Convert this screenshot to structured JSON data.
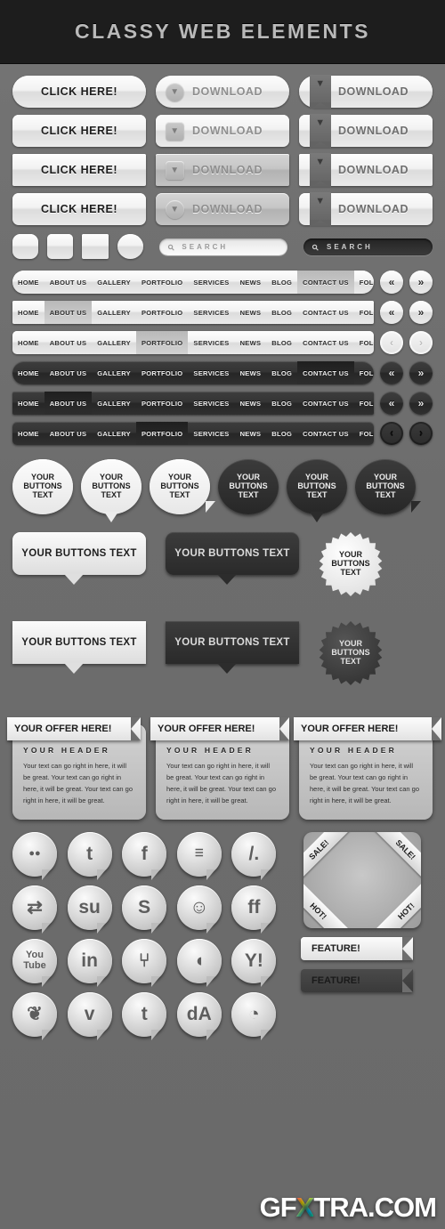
{
  "header": {
    "title": "CLASSY WEB ELEMENTS"
  },
  "buttons": {
    "click_label": "CLICK HERE!",
    "download_label": "DOWNLOAD",
    "rows": [
      {
        "shape": "pill"
      },
      {
        "shape": "soft"
      },
      {
        "shape": "square"
      },
      {
        "shape": "soft2"
      }
    ],
    "icons": {
      "chevron": "chevron-down-icon",
      "ribbon": "ribbon-bookmark-icon"
    }
  },
  "shapes": [
    {
      "name": "rounded-square-button"
    },
    {
      "name": "soft-square-button"
    },
    {
      "name": "square-button"
    },
    {
      "name": "circle-button"
    }
  ],
  "search": {
    "light_placeholder": "SEARCH",
    "dark_placeholder": "SEARCH",
    "icon": "magnifier-icon"
  },
  "nav": {
    "items": [
      "HOME",
      "ABOUT US",
      "GALLERY",
      "PORTFOLIO",
      "SERVICES",
      "NEWS",
      "BLOG",
      "CONTACT US",
      "FOLLOW US"
    ],
    "bars": [
      {
        "theme": "light",
        "shape": "pill",
        "active": "CONTACT US",
        "arrows": [
          "«",
          "»"
        ]
      },
      {
        "theme": "light",
        "shape": "square",
        "active": "ABOUT US",
        "arrows": [
          "«",
          "»"
        ]
      },
      {
        "theme": "light",
        "shape": "soft",
        "active": "PORTFOLIO",
        "arrows": [
          "‹",
          "›"
        ]
      },
      {
        "theme": "dark",
        "shape": "pill",
        "active": "CONTACT US",
        "arrows": [
          "«",
          "»"
        ]
      },
      {
        "theme": "dark",
        "shape": "square",
        "active": "ABOUT US",
        "arrows": [
          "«",
          "»"
        ]
      },
      {
        "theme": "dark",
        "shape": "soft",
        "active": "PORTFOLIO",
        "arrows": [
          "‹",
          "›"
        ]
      }
    ]
  },
  "bubbles": {
    "label_line1": "YOUR",
    "label_line2": "BUTTONS",
    "label_line3": "TEXT",
    "round": [
      {
        "theme": "light",
        "tail": "none"
      },
      {
        "theme": "light",
        "tail": "down"
      },
      {
        "theme": "light",
        "tail": "side"
      },
      {
        "theme": "dark",
        "tail": "none"
      },
      {
        "theme": "dark",
        "tail": "down"
      },
      {
        "theme": "dark",
        "tail": "side"
      }
    ]
  },
  "rect_bubbles": {
    "label": "YOUR BUTTONS TEXT",
    "items": [
      {
        "theme": "light",
        "corners": "rounded"
      },
      {
        "theme": "dark",
        "corners": "rounded"
      },
      {
        "theme": "light",
        "corners": "square"
      },
      {
        "theme": "dark",
        "corners": "square"
      }
    ],
    "badges": [
      {
        "theme": "light"
      },
      {
        "theme": "dark"
      }
    ]
  },
  "cards": {
    "ribbon_label": "YOUR OFFER HERE!",
    "header": "YOUR HEADER",
    "body": "Your text can go right in here, it will be great. Your text can go right in here, it will be great. Your text can go right in here, it will be great.",
    "count": 3
  },
  "social": [
    {
      "name": "flickr-icon",
      "glyph": "●●",
      "size": "sm"
    },
    {
      "name": "twitter-icon",
      "glyph": "t",
      "size": "lg"
    },
    {
      "name": "facebook-icon",
      "glyph": "f",
      "size": "lg"
    },
    {
      "name": "myspace-icon",
      "glyph": "☰",
      "size": "sm"
    },
    {
      "name": "slashdot-icon",
      "glyph": "/.",
      "size": "lg"
    },
    {
      "name": "retweet-icon",
      "glyph": "⇄",
      "size": "lg"
    },
    {
      "name": "stumbleupon-icon",
      "glyph": "su",
      "size": "lg"
    },
    {
      "name": "skype-icon",
      "glyph": "S",
      "size": "lg"
    },
    {
      "name": "reddit-icon",
      "glyph": "☺",
      "size": "lg"
    },
    {
      "name": "friendfeed-icon",
      "glyph": "ff",
      "size": "lg"
    },
    {
      "name": "youtube-icon",
      "glyph": "You\nTube",
      "size": "sm"
    },
    {
      "name": "linkedin-icon",
      "glyph": "in",
      "size": "lg"
    },
    {
      "name": "plancast-icon",
      "glyph": "⑂",
      "size": "lg"
    },
    {
      "name": "viddler-icon",
      "glyph": "◖",
      "size": "lg"
    },
    {
      "name": "yahoo-icon",
      "glyph": "Y!",
      "size": "lg"
    },
    {
      "name": "msn-butterfly-icon",
      "glyph": "❦",
      "size": "lg"
    },
    {
      "name": "vimeo-icon",
      "glyph": "v",
      "size": "lg"
    },
    {
      "name": "tumblr-icon",
      "glyph": "t",
      "size": "lg"
    },
    {
      "name": "deviantart-icon",
      "glyph": "dA",
      "size": "lg"
    },
    {
      "name": "rss-icon",
      "glyph": "◔",
      "size": "lg"
    }
  ],
  "corner_ribbons": {
    "sale_label": "SALE!",
    "hot_label": "HOT!"
  },
  "feature_tags": {
    "label": "FEATURE!",
    "variants": [
      "light",
      "dark"
    ]
  },
  "watermark": {
    "before": "GF",
    "x": "X",
    "after": "TRA.COM"
  },
  "colors": {
    "background": "#6f6f6f",
    "header_bg": "#1d1d1d",
    "header_text": "#b9b9b9",
    "light_surface": "#f2f2f2",
    "dark_surface": "#2e2e2e"
  }
}
